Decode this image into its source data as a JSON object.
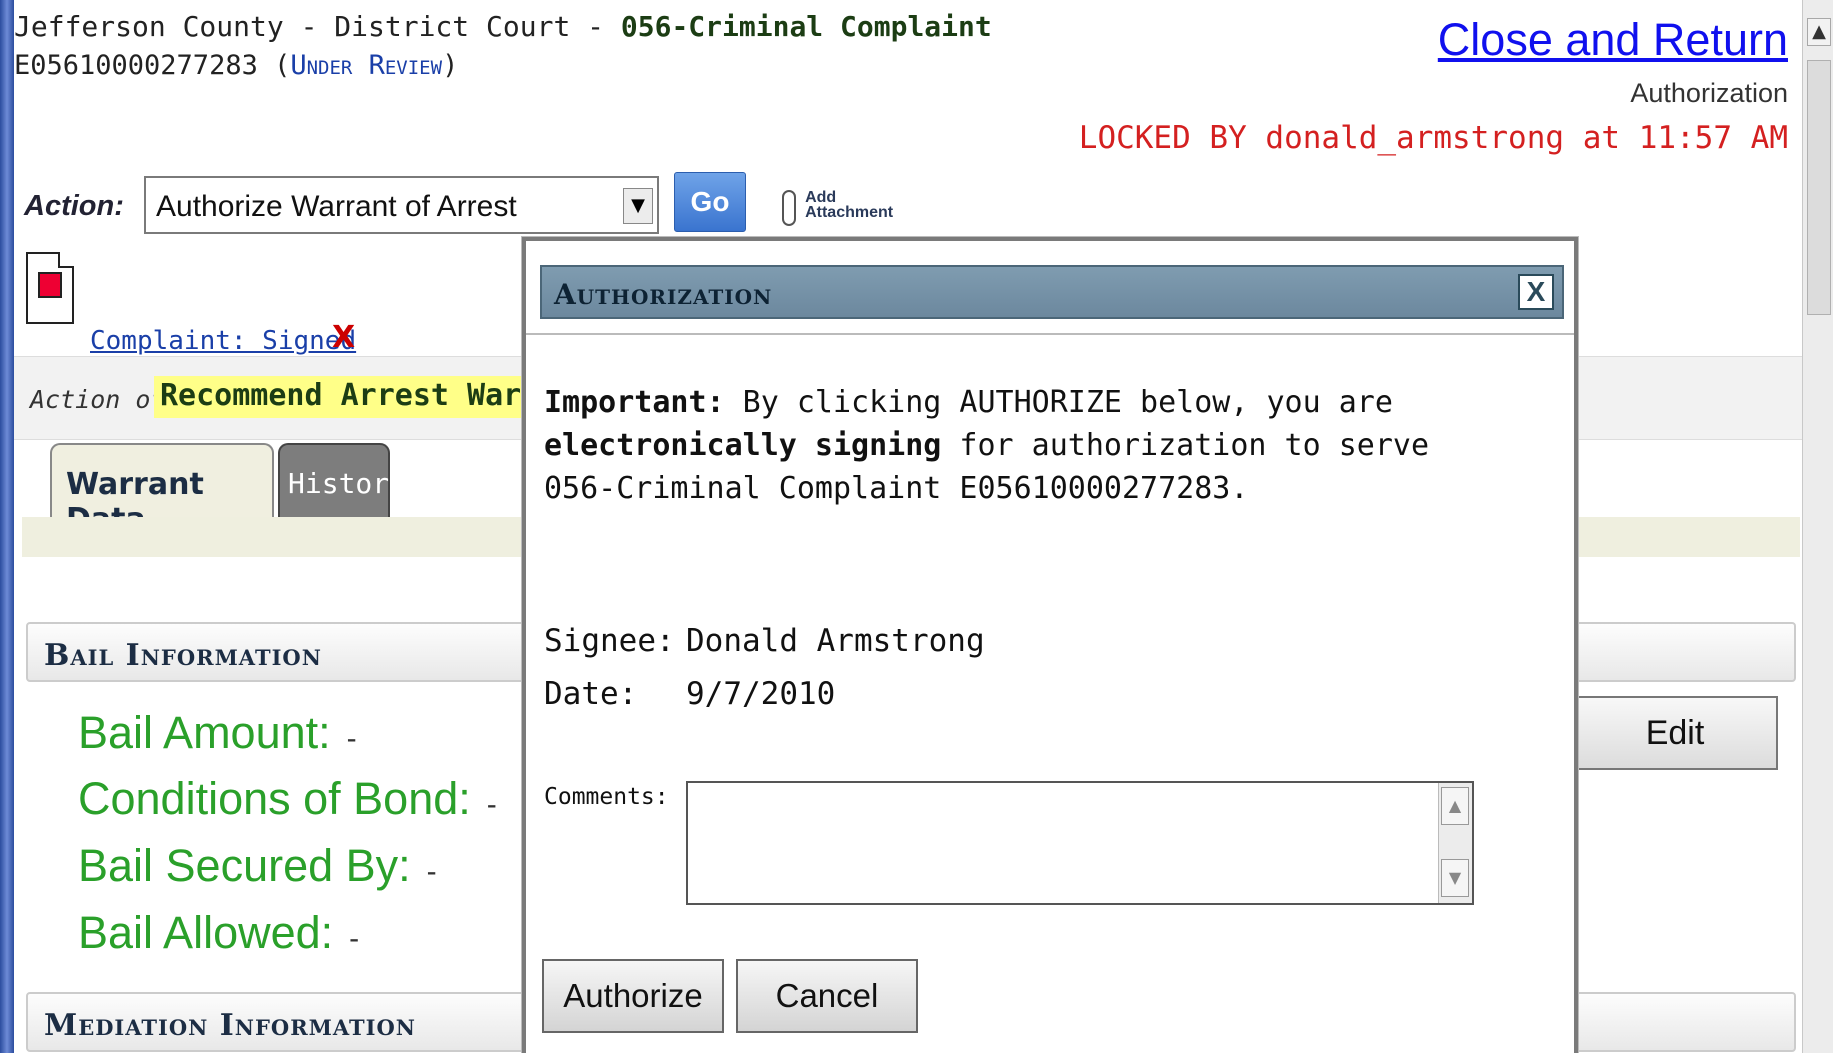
{
  "header": {
    "court": "Jefferson County - District Court - ",
    "doc_type": "056-Criminal Complaint",
    "case_no": "E05610000277283 (",
    "status": "Under Review",
    "case_close": ")",
    "close_link": "Close and Return",
    "mode": "Authorization",
    "locked": "LOCKED BY donald_armstrong at 11:57 AM"
  },
  "toolbar": {
    "action_label": "Action:",
    "action_value": "Authorize Warrant of Arrest",
    "go_label": "Go",
    "attach_line1": "Add",
    "attach_line2": "Attachment"
  },
  "document": {
    "link": "Complaint: Signed",
    "remove": "X"
  },
  "action_of": {
    "label": "Action of:",
    "value": "Recommend Arrest Warrant"
  },
  "tabs": [
    {
      "label": "Warrant Data",
      "active": true
    },
    {
      "label": "History",
      "active": false
    }
  ],
  "bail": {
    "title": "Bail Information",
    "rows": [
      {
        "label": "Bail Amount:",
        "value": "-"
      },
      {
        "label": "Conditions of Bond:",
        "value": "-"
      },
      {
        "label": "Bail Secured By:",
        "value": "-"
      },
      {
        "label": "Bail Allowed:",
        "value": "-"
      }
    ],
    "edit_label": "Edit"
  },
  "mediation": {
    "title": "Mediation Information"
  },
  "modal": {
    "title": "Authorization",
    "close": "X",
    "important": "Important:",
    "msg1": " By clicking AUTHORIZE below, you are ",
    "msg_bold": "electronically signing",
    "msg2": " for authorization to serve 056-Criminal Complaint E05610000277283.",
    "signee_label": "Signee:",
    "signee_value": "Donald Armstrong",
    "date_label": "Date:",
    "date_value": "9/7/2010",
    "comments_label": "Comments:",
    "comments_value": "",
    "authorize_label": "Authorize",
    "cancel_label": "Cancel"
  },
  "colors": {
    "accent": "#1a3fa8",
    "locked": "#d42020",
    "bail_label": "#2aa02a",
    "modal_title": "#6c889e",
    "highlight": "#ffff88"
  }
}
